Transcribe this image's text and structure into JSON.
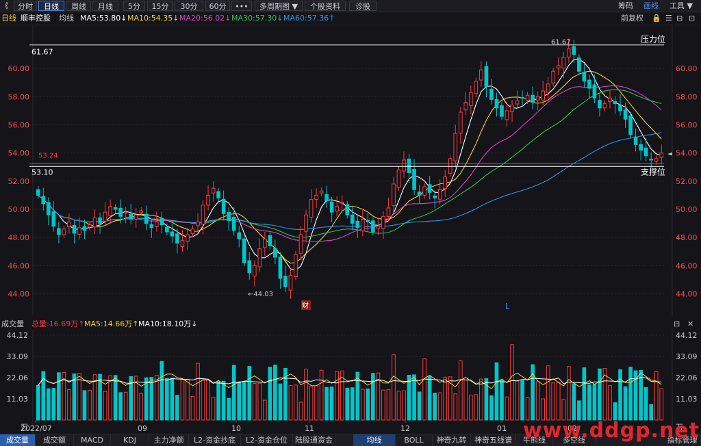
{
  "toolbar": {
    "back": "《",
    "tabs": [
      "分时",
      "日线",
      "周线",
      "月线",
      "5分",
      "15分",
      "30分",
      "60分",
      "•••",
      "多周期图 ▼",
      "个股资料",
      "诊股"
    ],
    "active_tab": "日线",
    "right": [
      "筹码",
      "画线",
      "工具 ▼"
    ]
  },
  "info": {
    "period": "日线",
    "stock": "顺丰控股",
    "ma_label": "均线",
    "ma5": "MA5:53.80↓",
    "ma10": "MA10:54.35↓",
    "ma20": "MA20:56.02↓",
    "ma30": "MA30:57.30↓",
    "ma60": "MA60:57.36↑",
    "adjust": "前复权",
    "lock_icon": "lock-icon"
  },
  "colors": {
    "up": "#ff3a3a",
    "down": "#00c5c9",
    "ma5": "#ffffff",
    "ma10": "#f5d12a",
    "ma20": "#e040c8",
    "ma30": "#27c750",
    "ma60": "#2f93f0"
  },
  "chart_data": [
    {
      "type": "candlestick",
      "ylim": [
        43.2,
        61.9
      ],
      "y_ticks": [
        "60.00",
        "58.00",
        "56.00",
        "54.00",
        "52.00",
        "50.00",
        "48.00",
        "46.00",
        "44.00"
      ],
      "annotations": {
        "high_line": "61.67",
        "high_mark": "61.67",
        "pressure": "压力位",
        "support_line": "53.24",
        "support_low": "53.10",
        "support": "支撑位",
        "low_mark": "←44.03",
        "current_marker": "◄",
        "current_price": "54.00",
        "cai_badge": "财",
        "l_marker": "L"
      },
      "close_series": [
        51.0,
        50.4,
        49.6,
        48.8,
        48.2,
        48.6,
        49.1,
        48.3,
        48.7,
        48.5,
        48.9,
        49.4,
        49.0,
        49.8,
        50.2,
        50.0,
        49.5,
        49.8,
        49.3,
        49.6,
        49.9,
        49.0,
        48.7,
        49.1,
        48.9,
        48.4,
        48.1,
        47.6,
        47.8,
        48.2,
        48.6,
        49.1,
        50.3,
        51.0,
        51.5,
        50.8,
        49.7,
        49.2,
        48.5,
        47.9,
        46.2,
        45.5,
        46.0,
        47.2,
        47.9,
        47.4,
        46.6,
        45.1,
        44.5,
        45.3,
        46.8,
        48.2,
        49.6,
        50.7,
        51.0,
        51.3,
        50.6,
        49.8,
        50.2,
        50.5,
        49.6,
        49.0,
        48.7,
        49.3,
        49.1,
        48.4,
        48.8,
        49.5,
        50.1,
        51.8,
        52.8,
        53.5,
        52.6,
        51.4,
        51.0,
        51.6,
        51.2,
        50.8,
        51.4,
        52.3,
        53.6,
        55.4,
        56.9,
        57.6,
        58.3,
        59.1,
        59.9,
        58.7,
        57.8,
        57.2,
        56.6,
        57.0,
        57.4,
        57.7,
        57.9,
        58.1,
        57.6,
        58.0,
        58.4,
        58.9,
        59.8,
        60.2,
        60.8,
        61.4,
        61.0,
        59.8,
        59.1,
        58.6,
        57.9,
        57.2,
        57.5,
        57.9,
        57.5,
        57.0,
        56.4,
        55.3,
        54.6,
        54.2,
        53.8,
        53.5,
        53.6,
        54.0
      ],
      "ma_series": {
        "MA5": "white line",
        "MA10": "yellow line",
        "MA20": "magenta line",
        "MA30": "green line",
        "MA60": "blue line"
      }
    },
    {
      "type": "bar",
      "title": "成交量",
      "y_ticks": [
        "44.12",
        "33.09",
        "22.06",
        "11.03",
        "万"
      ],
      "x_ticks": [
        "2022/07",
        "09",
        "10",
        "11",
        "12",
        "01",
        "02"
      ],
      "ylim": [
        0,
        44.12
      ]
    }
  ],
  "volume": {
    "label": "成交量",
    "total": "总量:16.69万↑",
    "ma5": "MA5:14.66万↑",
    "ma10": "MA10:18.10万↓"
  },
  "bottom_tabs": [
    "成交量",
    "成交额",
    "MACD",
    "KDJ",
    "主力净额",
    "L2-资金抄底",
    "L2-资金仓位",
    "陆股通资金",
    "均线",
    "BOLL",
    "神奇九转",
    "神奇五线谱",
    "牛熊线",
    "多空线",
    "指标管理"
  ],
  "bottom_active": "成交量",
  "bottom_active2": "均线",
  "watermark": "www.ddgp.net"
}
